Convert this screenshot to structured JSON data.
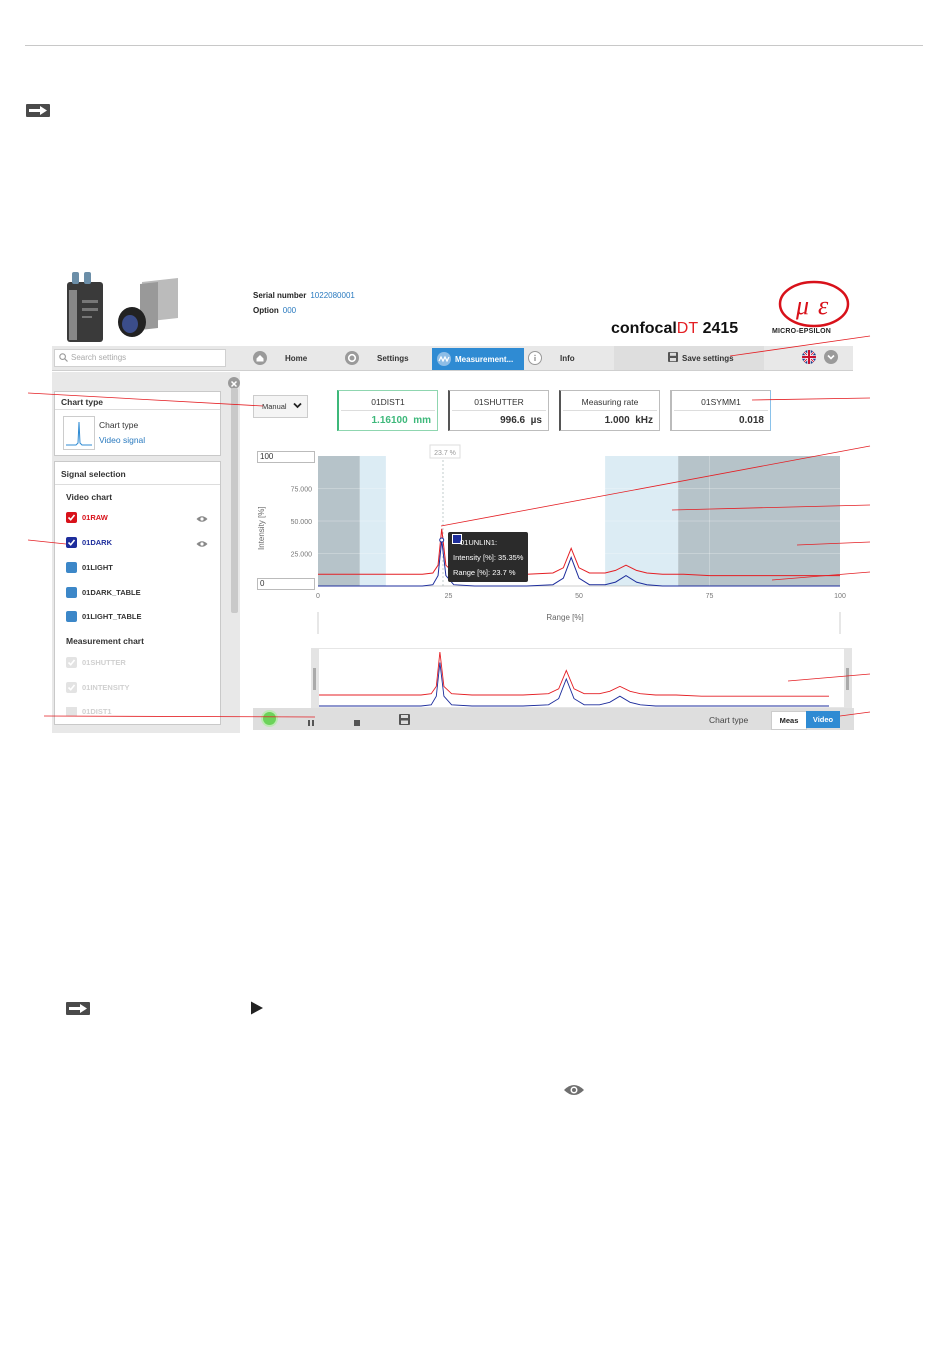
{
  "header": {
    "serial_label": "Serial number",
    "serial_value": "1022080001",
    "option_label": "Option",
    "option_value": "000",
    "product_prefix": "confocal",
    "product_red": "DT",
    "product_suffix": " 2415",
    "logo_text": "MICRO-EPSILON"
  },
  "nav": {
    "search_placeholder": "Search settings",
    "home": "Home",
    "settings": "Settings",
    "measurement": "Measurement...",
    "info": "Info",
    "save": "Save settings"
  },
  "sidebar": {
    "chart_type_title": "Chart type",
    "chart_type_label": "Chart type",
    "chart_type_value": "Video signal",
    "signal_selection_title": "Signal selection",
    "video_chart_title": "Video chart",
    "video_signals": [
      {
        "name": "01RAW",
        "color": "#d8111a"
      },
      {
        "name": "01DARK",
        "color": "#1d2d9c"
      },
      {
        "name": "01LIGHT",
        "color": "#333333"
      },
      {
        "name": "01DARK_TABLE",
        "color": "#333333"
      },
      {
        "name": "01LIGHT_TABLE",
        "color": "#333333"
      }
    ],
    "measurement_chart_title": "Measurement chart",
    "measurement_signals": [
      "01SHUTTER",
      "01INTENSITY",
      "01DIST1"
    ]
  },
  "main": {
    "mode": "Manual",
    "values": [
      {
        "label": "01DIST1",
        "value": "1.16100",
        "unit": "mm",
        "color": "#3db87a"
      },
      {
        "label": "01SHUTTER",
        "value": "996.6",
        "unit": "µs",
        "color": "#333333"
      },
      {
        "label": "Measuring rate",
        "value": "1.000",
        "unit": "kHz",
        "color": "#333333"
      },
      {
        "label": "01SYMM1",
        "value": "0.018",
        "unit": "",
        "color": "#333333"
      }
    ],
    "y_max_input": "100",
    "y_min_input": "0",
    "cursor_label": "23.7 %",
    "tooltip": {
      "title": "01UNLIN1:",
      "intensity": "Intensity [%]: 35.35%",
      "range": "Range [%]: 23.7 %"
    }
  },
  "chart_data": {
    "type": "line",
    "xlabel": "Range [%]",
    "ylabel": "Intensity [%]",
    "xlim": [
      0,
      100
    ],
    "ylim": [
      0,
      100
    ],
    "x_ticks": [
      "0",
      "25",
      "50",
      "75",
      "100"
    ],
    "y_ticks": [
      "25.000",
      "50.000",
      "75.000"
    ],
    "series": [
      {
        "name": "01RAW",
        "color": "#e41f24",
        "x": [
          0,
          20,
          22,
          23,
          23.7,
          24.5,
          26,
          30,
          40,
          45,
          47,
          48.5,
          50,
          52,
          55,
          57,
          59,
          61,
          63,
          66,
          70,
          75,
          80,
          100
        ],
        "y": [
          9,
          9,
          10,
          16,
          44,
          16,
          10,
          9,
          9,
          10,
          14,
          29,
          14,
          10,
          10,
          12,
          16,
          12,
          10,
          9,
          9,
          8,
          8,
          8
        ]
      },
      {
        "name": "01DARK",
        "color": "#1d2d9c",
        "x": [
          0,
          20,
          22,
          23,
          23.7,
          24.5,
          26,
          30,
          40,
          45,
          47,
          48.5,
          50,
          52,
          55,
          57,
          59,
          61,
          63,
          66,
          70,
          100
        ],
        "y": [
          0,
          0,
          1,
          8,
          35.35,
          8,
          1,
          0,
          0,
          1,
          6,
          22,
          6,
          1,
          1,
          3,
          8,
          3,
          1,
          0,
          0,
          0
        ]
      }
    ],
    "highlight_regions": [
      {
        "from": 8,
        "to": 13,
        "kind": "light"
      },
      {
        "from": 55,
        "to": 69,
        "kind": "light"
      },
      {
        "from": 0,
        "to": 8,
        "kind": "dark"
      },
      {
        "from": 69,
        "to": 100,
        "kind": "dark"
      }
    ]
  },
  "bottombar": {
    "chart_type_label": "Chart type",
    "meas": "Meas",
    "video": "Video"
  },
  "colors": {
    "accent": "#2f8bd3",
    "annotation_line": "#e41f24"
  }
}
